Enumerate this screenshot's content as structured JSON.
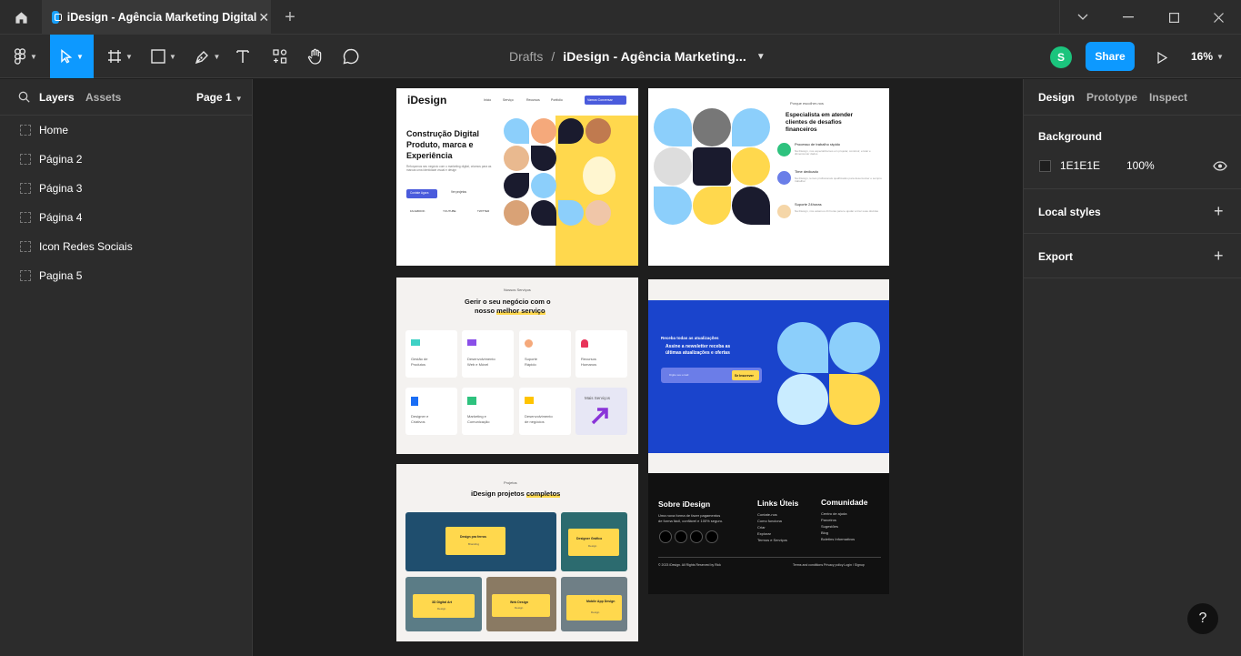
{
  "tab": {
    "title": "iDesign - Agência Marketing Digital"
  },
  "header": {
    "breadcrumb_root": "Drafts",
    "breadcrumb_sep": "/",
    "file_name": "iDesign - Agência Marketing...",
    "avatar_initial": "S",
    "share_label": "Share",
    "zoom": "16%"
  },
  "left_panel": {
    "tab_layers": "Layers",
    "tab_assets": "Assets",
    "page_selector": "Page 1",
    "layers": [
      {
        "label": "Home"
      },
      {
        "label": "Página 2"
      },
      {
        "label": "Página 3"
      },
      {
        "label": "Página 4"
      },
      {
        "label": "Icon Redes Sociais"
      },
      {
        "label": "Pagina 5"
      }
    ]
  },
  "right_panel": {
    "tabs": [
      "Design",
      "Prototype",
      "Inspect"
    ],
    "background_label": "Background",
    "bg_hex": "1E1E1E",
    "bg_opacity": "100%",
    "local_styles": "Local styles",
    "export": "Export"
  },
  "colors": {
    "accent": "#0d99ff",
    "yellow": "#ffd84d",
    "lightblue": "#8ccffb",
    "navy": "#1a1b2e",
    "footer": "#111111",
    "newsletter": "#1a44cc"
  },
  "mock": {
    "home": {
      "logo": "iDesign",
      "nav": [
        "Inicio",
        "Serviço",
        "Recursos",
        "Portfolio"
      ],
      "cta": "Vamos Conversar",
      "headline_1": "Construção Digital",
      "headline_2": "Produto, marca e",
      "headline_3": "Experiência",
      "body": "Reforçamos seu negócio com o marketing digital, criamos para as marcas uma identidade visual e design",
      "primary_btn": "Contate Agora",
      "secondary": "Ver projetos",
      "social": [
        "FACEBOOK",
        "YOUTUBE",
        "TWITTER"
      ]
    },
    "p2": {
      "eyebrow": "Porque escolher-nos",
      "title_1": "Especialista em atender",
      "title_2": "clientes de desafios",
      "title_3": "financeiros",
      "features": [
        {
          "title": "Processo de trabalho rápido",
          "body": "Na iDesign, nos especializamos em projetar, construir, enviar e dimensionar dados"
        },
        {
          "title": "Time dedicado",
          "body": "Na iDesign, temos profissionais qualificados para desenvolver e sempre trabalhar"
        },
        {
          "title": "Suporte 24horas",
          "body": "Na iDesign, nós estamos 24 horas para te ajudar a tirar suas dúvidas"
        }
      ]
    },
    "services": {
      "eyebrow": "Nossos Serviços",
      "title_1": "Gerir o seu negócio com o",
      "title_2a": "nosso ",
      "title_2b": "melhor serviço",
      "cards": [
        {
          "l1": "Gestão de",
          "l2": "Produtos"
        },
        {
          "l1": "Desenvolvimento",
          "l2": "Web e Móvel"
        },
        {
          "l1": "Suporte",
          "l2": "Rápido"
        },
        {
          "l1": "Recursos",
          "l2": "Humanos"
        },
        {
          "l1": "Designer e",
          "l2": "Criativos"
        },
        {
          "l1": "Marketing e",
          "l2": "Comunicação"
        },
        {
          "l1": "Desenvolvimento",
          "l2": "de negócios"
        }
      ],
      "more": "Mais Serviços"
    },
    "newsletter": {
      "eyebrow": "Receba todas as atualizações",
      "title_1": "Assine a newsletter receba as",
      "title_2": "últimas atualizações e ofertas",
      "placeholder": "Digite seu email",
      "btn": "Se Inscrever"
    },
    "projects": {
      "eyebrow": "Projetos",
      "title_a": "iDesign projetos ",
      "title_b": "completos",
      "items": [
        {
          "title": "Design pra ferros",
          "sub": "Branding"
        },
        {
          "title": "Designer Gráfico",
          "sub": "Design"
        },
        {
          "title": "3D Digital Art",
          "sub": "Design"
        },
        {
          "title": "Web Design",
          "sub": "Design"
        },
        {
          "title": "Mobile App Design",
          "sub": "Design"
        }
      ]
    },
    "footer": {
      "about_title": "Sobre iDesign",
      "about_1": "Uma nova forma de fazer pagamentos",
      "about_2": "de forma fácil, confiável e 100% seguro.",
      "links_title": "Links Úteis",
      "links": [
        "Contate-nos",
        "Como funciona",
        "Criar",
        "Explorar",
        "Termos e Serviços"
      ],
      "comm_title": "Comunidade",
      "comm": [
        "Centro de ajuda",
        "Parceiros",
        "Sugestões",
        "Blog",
        "Boletins Informativos"
      ],
      "copyright": "© 2023 iDesign. All Rights Reserved by Rick",
      "legal": "Terms and conditions Privacy policy  Login / Signup"
    }
  }
}
